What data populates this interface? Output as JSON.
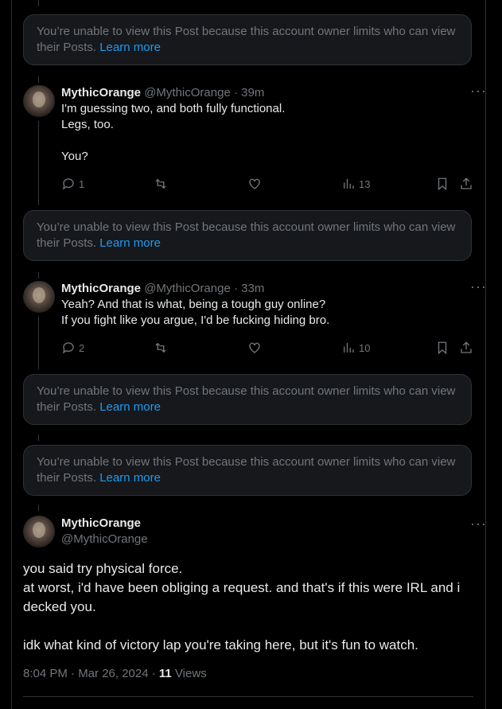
{
  "notice": {
    "text": "You’re unable to view this Post because this account owner limits who can view their Posts.",
    "link": "Learn more"
  },
  "replies": [
    {
      "name": "MythicOrange",
      "handle": "@MythicOrange",
      "time": "· 39m",
      "lines": [
        "I'm guessing two, and both fully functional.",
        "Legs, too.",
        "",
        "You?"
      ],
      "replies_count": "1",
      "views": "13"
    },
    {
      "name": "MythicOrange",
      "handle": "@MythicOrange",
      "time": "· 33m",
      "lines": [
        "Yeah? And that is what, being a tough guy online?",
        "If you fight like you argue, I'd be fucking hiding bro."
      ],
      "replies_count": "2",
      "views": "10"
    }
  ],
  "main_post": {
    "name": "MythicOrange",
    "handle": "@MythicOrange",
    "text_lines": [
      "you said try physical force.",
      "at worst, i'd have been obliging a request. and that's if this were IRL and i",
      "decked you.",
      "",
      "idk what kind of victory lap you're taking here, but it's fun to watch."
    ],
    "timestamp": "8:04 PM · Mar 26, 2024 · ",
    "views_count": "11",
    "views_label": " Views"
  },
  "icons": [
    "more-icon",
    "reply-icon",
    "retweet-icon",
    "like-icon",
    "views-icon",
    "bookmark-icon",
    "share-icon"
  ]
}
